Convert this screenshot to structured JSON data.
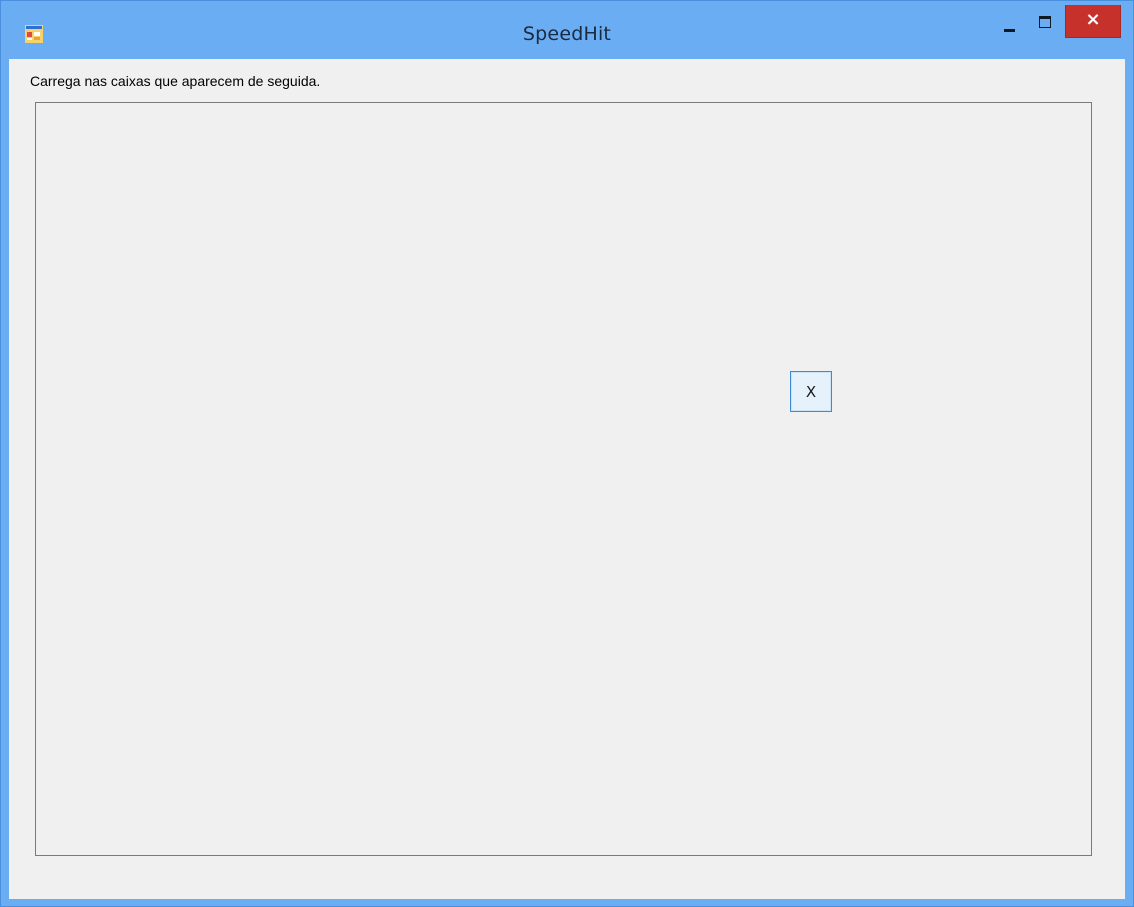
{
  "window": {
    "title": "SpeedHit",
    "app_icon": "windows-form-icon",
    "controls": {
      "minimize_icon": "minimize-icon",
      "maximize_icon": "maximize-icon",
      "close_icon": "close-icon",
      "close_glyph": "×"
    },
    "colors": {
      "titlebar": "#6aadf3",
      "close_button": "#c7312c",
      "client_background": "#f0f0f0",
      "target_border": "#3c8ad8"
    }
  },
  "main": {
    "instruction": "Carrega nas caixas que aparecem de seguida.",
    "target_label": "X"
  }
}
